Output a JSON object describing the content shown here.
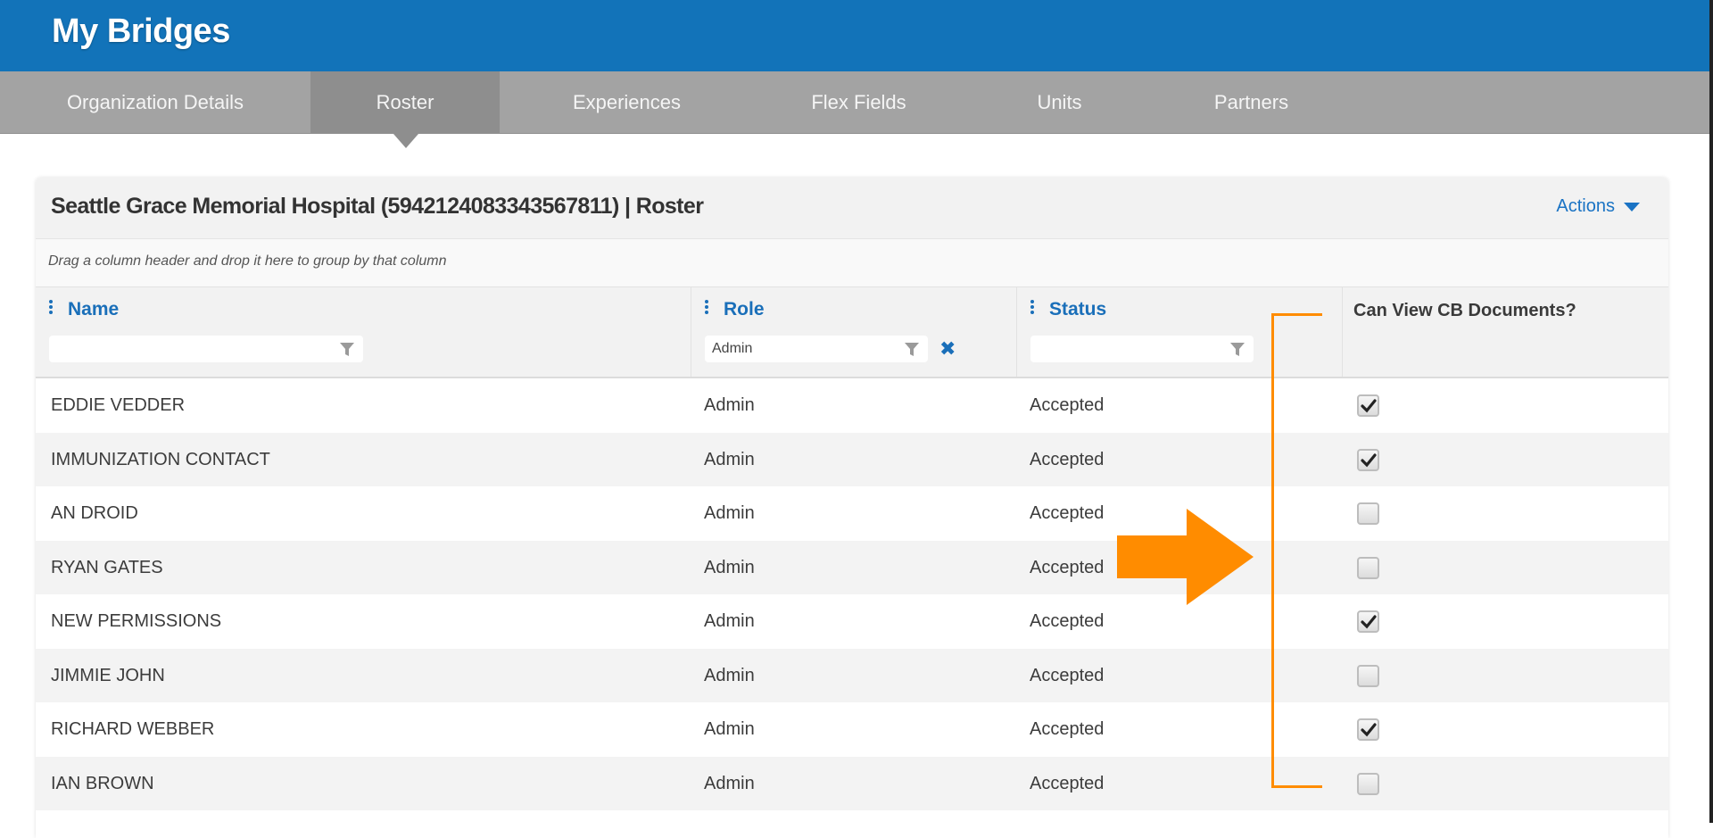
{
  "app": {
    "title": "My Bridges"
  },
  "tabs": [
    {
      "label": "Organization Details",
      "active": false
    },
    {
      "label": "Roster",
      "active": true
    },
    {
      "label": "Experiences",
      "active": false
    },
    {
      "label": "Flex Fields",
      "active": false
    },
    {
      "label": "Units",
      "active": false
    },
    {
      "label": "Partners",
      "active": false
    }
  ],
  "card": {
    "title": "Seattle Grace Memorial Hospital (5942124083343567811) | Roster",
    "actions_label": "Actions",
    "groupbar_hint": "Drag a column header and drop it here to group by that column"
  },
  "columns": {
    "name": {
      "label": "Name",
      "filter_value": ""
    },
    "role": {
      "label": "Role",
      "filter_value": "Admin"
    },
    "status": {
      "label": "Status",
      "filter_value": ""
    },
    "can_view": {
      "label": "Can View CB Documents?"
    }
  },
  "rows": [
    {
      "name": "EDDIE VEDDER",
      "role": "Admin",
      "status": "Accepted",
      "can_view": true
    },
    {
      "name": "IMMUNIZATION CONTACT",
      "role": "Admin",
      "status": "Accepted",
      "can_view": true
    },
    {
      "name": "AN DROID",
      "role": "Admin",
      "status": "Accepted",
      "can_view": false
    },
    {
      "name": "RYAN GATES",
      "role": "Admin",
      "status": "Accepted",
      "can_view": false
    },
    {
      "name": "NEW PERMISSIONS",
      "role": "Admin",
      "status": "Accepted",
      "can_view": true
    },
    {
      "name": "JIMMIE JOHN",
      "role": "Admin",
      "status": "Accepted",
      "can_view": false
    },
    {
      "name": "RICHARD WEBBER",
      "role": "Admin",
      "status": "Accepted",
      "can_view": true
    },
    {
      "name": "IAN BROWN",
      "role": "Admin",
      "status": "Accepted",
      "can_view": false
    }
  ],
  "colors": {
    "header_blue": "#1273b9",
    "tab_gray": "#a3a3a3",
    "tab_active": "#8e8e8e",
    "link_blue": "#1a6fb9",
    "annotation_orange": "#ff8c00"
  }
}
